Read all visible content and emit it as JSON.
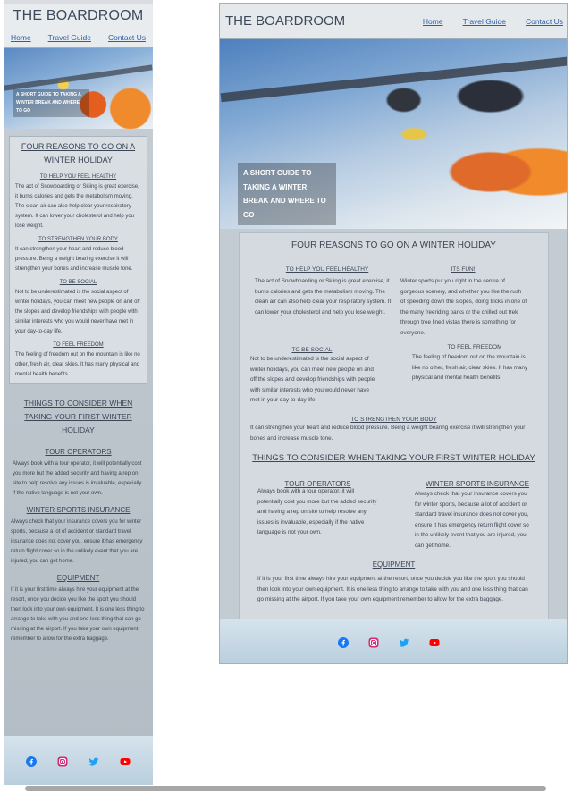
{
  "site": {
    "title": "THE BOARDROOM",
    "nav": [
      "Home",
      "Travel Guide",
      "Contact Us"
    ]
  },
  "hero": {
    "caption": "A SHORT GUIDE TO TAKING A WINTER BREAK AND WHERE TO GO"
  },
  "reasons": {
    "title": "FOUR REASONS TO GO ON A WINTER HOLIDAY",
    "items": [
      {
        "heading": "TO HELP YOU FEEL HEALTHY",
        "text": "The act of Snowboarding or Skiing is great exercise, it burns calories and gets the metabolism moving. The clean air can also help clear your respiratory system. It can lower your cholesterol and help you lose weight."
      },
      {
        "heading": "TO STRENGTHEN YOUR BODY",
        "text": "It can strengthen your heart and reduce blood pressure. Being a weight bearing exercise it will strengthen your bones and increase muscle tone."
      },
      {
        "heading": "TO BE SOCIAL",
        "text": "Not to be underestimated is the social aspect of winter holidays, you can meet new people on and off the slopes and develop friendships with people with similar interests who you would never have met in your day-to-day life."
      },
      {
        "heading": "TO FEEL FREEDOM",
        "text": "The feeling of freedom out on the mountain is like no other, fresh air, clear skies. It has many physical and mental health benefits."
      },
      {
        "heading": "ITS FUN!",
        "text": "Winter sports put you right in the centre of gorgeous scenery, and whether you like the rush of speeding down the slopes, doing tricks in one of the many freeriding parks or the chilled out trek through tree lined vistas there is something for everyone."
      }
    ]
  },
  "consider": {
    "title": "THINGS TO CONSIDER WHEN TAKING YOUR FIRST WINTER HOLIDAY",
    "sections": [
      {
        "heading": "TOUR OPERATORS",
        "text": "Always book with a tour operator, it will potentially cost you more but the added security and having a rep on site to help resolve any issues is invaluable, especially if the native language is not your own."
      },
      {
        "heading": "WINTER SPORTS INSURANCE",
        "text": "Always check that your insurance covers you for winter sports, because a lot of accident or standard travel insurance does not cover you, ensure it has emergency return flight cover so in the unlikely event that you are injured, you can get home."
      },
      {
        "heading": "EQUIPMENT",
        "text": "If it is your first time always hire your equipment at the resort, once you decide you like the sport you should then look into your own equipment. It is one less thing to arrange to take with you and one less thing that can go missing at the airport. If you take your own equipment remember to allow for the extra baggage."
      }
    ]
  },
  "social_icons": [
    {
      "name": "facebook-icon",
      "color": "#1877f2"
    },
    {
      "name": "instagram-icon",
      "color": "#d62976"
    },
    {
      "name": "twitter-icon",
      "color": "#1da1f2"
    },
    {
      "name": "youtube-icon",
      "color": "#ff0000"
    }
  ]
}
